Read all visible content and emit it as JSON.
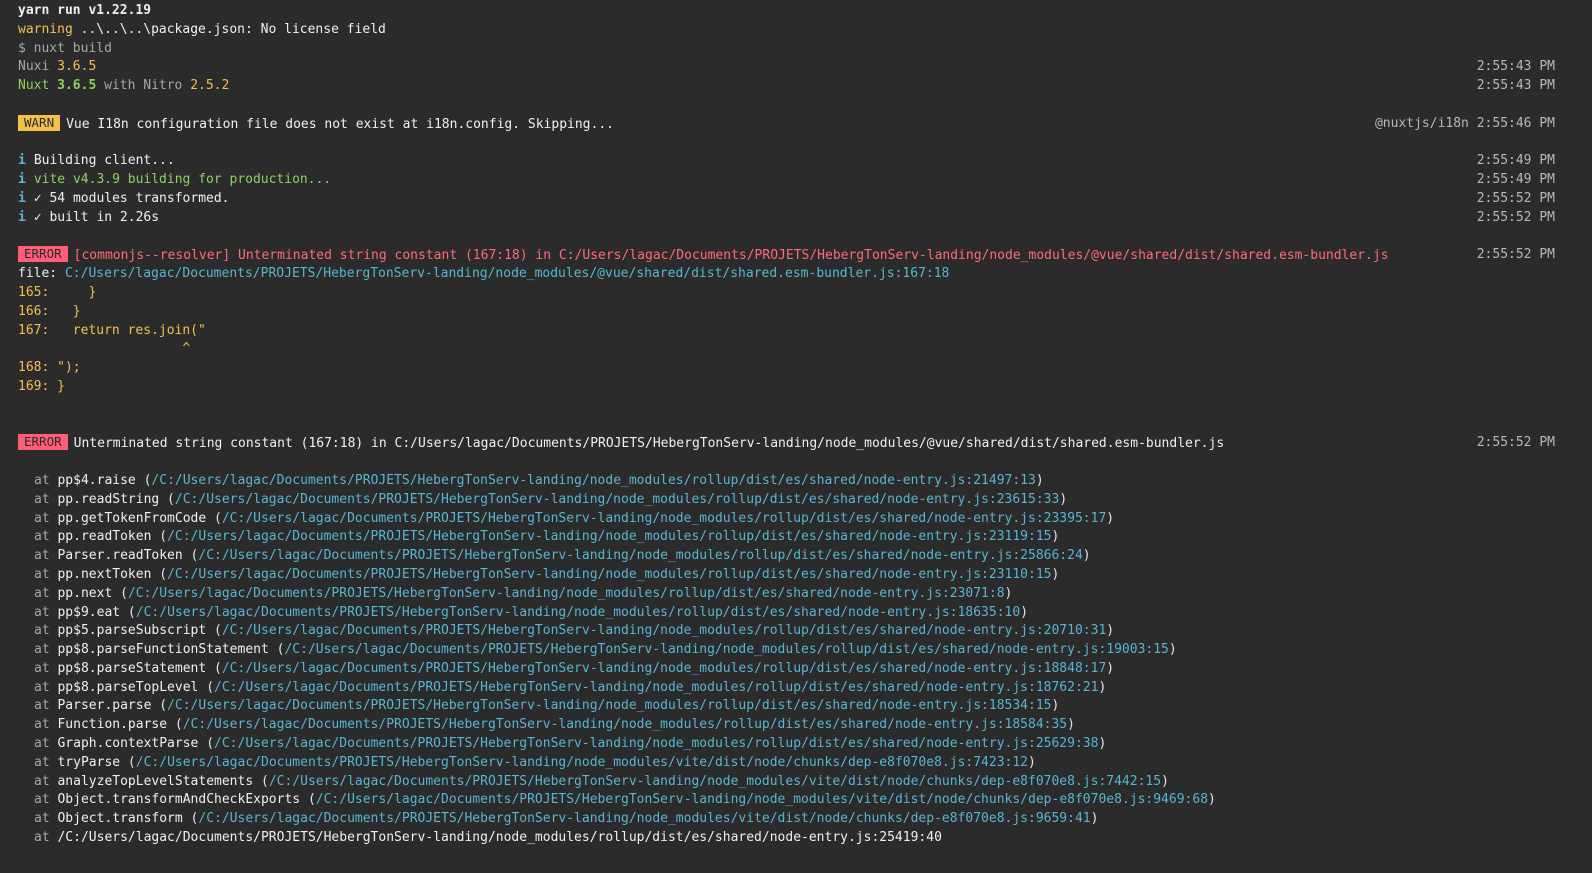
{
  "header": {
    "yarn_run": "yarn run v1.22.19",
    "warning_label": "warning",
    "warning_text": " ..\\..\\..\\package.json: No license field",
    "command": "$ nuxt build",
    "nuxi_label": "Nuxi ",
    "nuxi_version": "3.6.5",
    "nuxi_time": "2:55:43 PM",
    "nuxt_label": "Nuxt ",
    "nuxt_version": "3.6.5",
    "nuxt_with": " with Nitro ",
    "nitro_version": "2.5.2",
    "nuxt_time": "2:55:43 PM"
  },
  "warn": {
    "badge": "WARN",
    "message": "Vue I18n configuration file does not exist at i18n.config. Skipping...",
    "tag": "@nuxtjs/i18n",
    "time": "2:55:46 PM"
  },
  "info": [
    {
      "icon": "i",
      "text": "Building client...",
      "time": "2:55:49 PM",
      "color": "white"
    },
    {
      "icon": "i",
      "text": "vite v4.3.9 building for production...",
      "time": "2:55:49 PM",
      "color": "green"
    },
    {
      "icon": "i",
      "text": "✓ 54 modules transformed.",
      "time": "2:55:52 PM",
      "color": "white"
    },
    {
      "icon": "i",
      "text": "✓ built in 2.26s",
      "time": "2:55:52 PM",
      "color": "white"
    }
  ],
  "error1": {
    "badge": "ERROR",
    "message": "[commonjs--resolver] Unterminated string constant (167:18) in C:/Users/lagac/Documents/PROJETS/HebergTonServ-landing/node_modules/@vue/shared/dist/shared.esm-bundler.js",
    "time": "2:55:52 PM",
    "file_label": "file: ",
    "file_path": "C:/Users/lagac/Documents/PROJETS/HebergTonServ-landing/node_modules/@vue/shared/dist/shared.esm-bundler.js:167:18",
    "code_lines": [
      "165:     }",
      "166:   }",
      "167:   return res.join(\"",
      "                     ^",
      "168: \");",
      "169: }"
    ]
  },
  "error2": {
    "badge": "ERROR",
    "message": "Unterminated string constant (167:18) in C:/Users/lagac/Documents/PROJETS/HebergTonServ-landing/node_modules/@vue/shared/dist/shared.esm-bundler.js",
    "time": "2:55:52 PM"
  },
  "stack": [
    {
      "fn": "pp$4.raise",
      "path": "/C:/Users/lagac/Documents/PROJETS/HebergTonServ-landing/node_modules/rollup/dist/es/shared/node-entry.js:21497:13"
    },
    {
      "fn": "pp.readString",
      "path": "/C:/Users/lagac/Documents/PROJETS/HebergTonServ-landing/node_modules/rollup/dist/es/shared/node-entry.js:23615:33"
    },
    {
      "fn": "pp.getTokenFromCode",
      "path": "/C:/Users/lagac/Documents/PROJETS/HebergTonServ-landing/node_modules/rollup/dist/es/shared/node-entry.js:23395:17"
    },
    {
      "fn": "pp.readToken",
      "path": "/C:/Users/lagac/Documents/PROJETS/HebergTonServ-landing/node_modules/rollup/dist/es/shared/node-entry.js:23119:15"
    },
    {
      "fn": "Parser.readToken",
      "path": "/C:/Users/lagac/Documents/PROJETS/HebergTonServ-landing/node_modules/rollup/dist/es/shared/node-entry.js:25866:24"
    },
    {
      "fn": "pp.nextToken",
      "path": "/C:/Users/lagac/Documents/PROJETS/HebergTonServ-landing/node_modules/rollup/dist/es/shared/node-entry.js:23110:15"
    },
    {
      "fn": "pp.next",
      "path": "/C:/Users/lagac/Documents/PROJETS/HebergTonServ-landing/node_modules/rollup/dist/es/shared/node-entry.js:23071:8"
    },
    {
      "fn": "pp$9.eat",
      "path": "/C:/Users/lagac/Documents/PROJETS/HebergTonServ-landing/node_modules/rollup/dist/es/shared/node-entry.js:18635:10"
    },
    {
      "fn": "pp$5.parseSubscript",
      "path": "/C:/Users/lagac/Documents/PROJETS/HebergTonServ-landing/node_modules/rollup/dist/es/shared/node-entry.js:20710:31"
    },
    {
      "fn": "pp$8.parseFunctionStatement",
      "path": "/C:/Users/lagac/Documents/PROJETS/HebergTonServ-landing/node_modules/rollup/dist/es/shared/node-entry.js:19003:15"
    },
    {
      "fn": "pp$8.parseStatement",
      "path": "/C:/Users/lagac/Documents/PROJETS/HebergTonServ-landing/node_modules/rollup/dist/es/shared/node-entry.js:18848:17"
    },
    {
      "fn": "pp$8.parseTopLevel",
      "path": "/C:/Users/lagac/Documents/PROJETS/HebergTonServ-landing/node_modules/rollup/dist/es/shared/node-entry.js:18762:21"
    },
    {
      "fn": "Parser.parse",
      "path": "/C:/Users/lagac/Documents/PROJETS/HebergTonServ-landing/node_modules/rollup/dist/es/shared/node-entry.js:18534:15"
    },
    {
      "fn": "Function.parse",
      "path": "/C:/Users/lagac/Documents/PROJETS/HebergTonServ-landing/node_modules/rollup/dist/es/shared/node-entry.js:18584:35"
    },
    {
      "fn": "Graph.contextParse",
      "path": "/C:/Users/lagac/Documents/PROJETS/HebergTonServ-landing/node_modules/rollup/dist/es/shared/node-entry.js:25629:38"
    },
    {
      "fn": "tryParse",
      "path": "/C:/Users/lagac/Documents/PROJETS/HebergTonServ-landing/node_modules/vite/dist/node/chunks/dep-e8f070e8.js:7423:12"
    },
    {
      "fn": "analyzeTopLevelStatements",
      "path": "/C:/Users/lagac/Documents/PROJETS/HebergTonServ-landing/node_modules/vite/dist/node/chunks/dep-e8f070e8.js:7442:15"
    },
    {
      "fn": "Object.transformAndCheckExports",
      "path": "/C:/Users/lagac/Documents/PROJETS/HebergTonServ-landing/node_modules/vite/dist/node/chunks/dep-e8f070e8.js:9469:68"
    },
    {
      "fn": "Object.transform",
      "path": "/C:/Users/lagac/Documents/PROJETS/HebergTonServ-landing/node_modules/vite/dist/node/chunks/dep-e8f070e8.js:9659:41"
    },
    {
      "fn": "",
      "path": "/C:/Users/lagac/Documents/PROJETS/HebergTonServ-landing/node_modules/rollup/dist/es/shared/node-entry.js:25419:40",
      "plain": true
    }
  ],
  "colors": {
    "background": "#2b2b2b",
    "warn_badge": "#f2c14b",
    "error_badge": "#ff5e78",
    "path": "#56b6d4",
    "green": "#8cd35d"
  }
}
